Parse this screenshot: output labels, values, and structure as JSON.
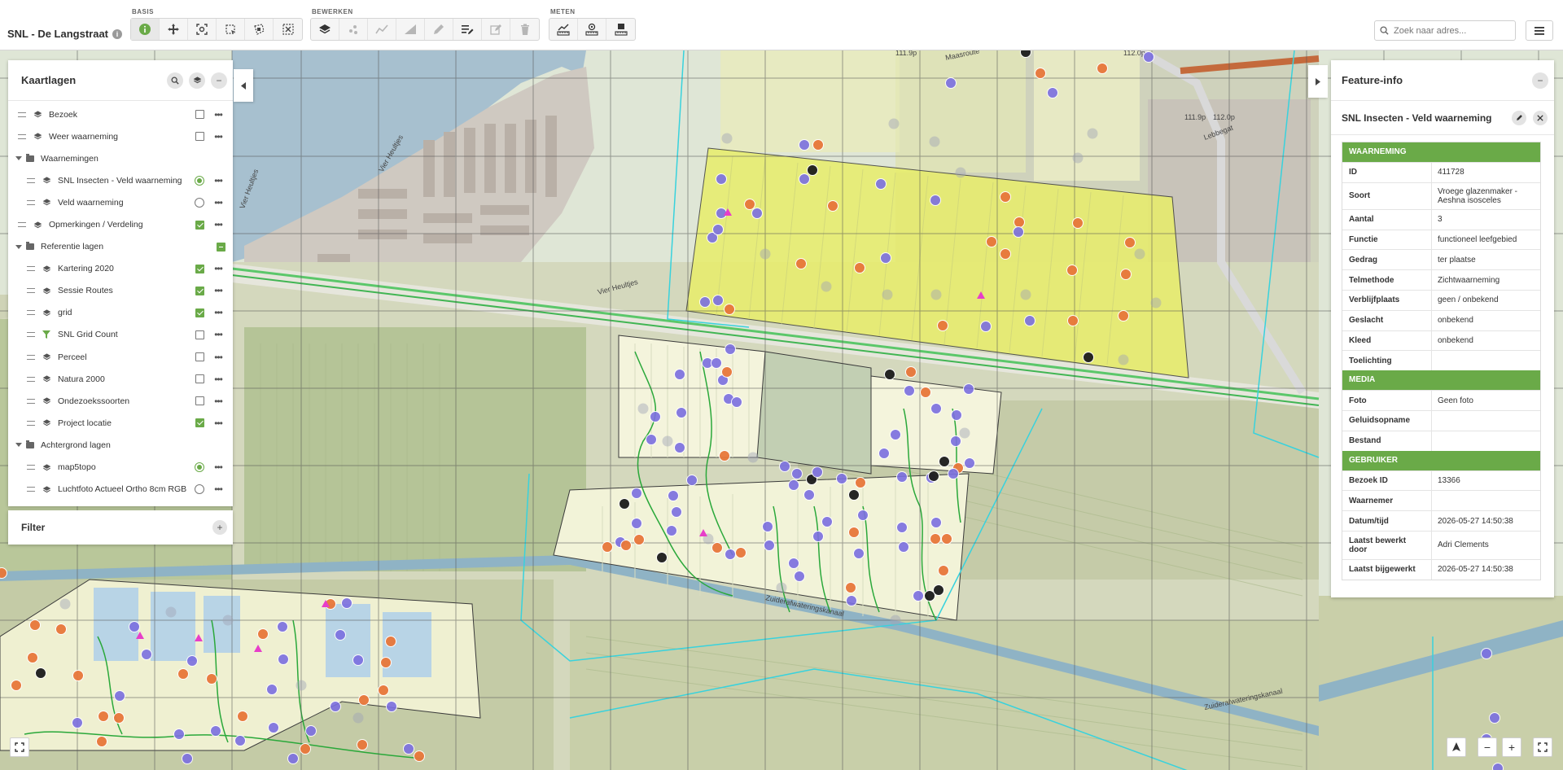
{
  "app": {
    "title": "SNL - De Langstraat",
    "info_icon": "info-icon"
  },
  "toolbar": {
    "groups": [
      {
        "label": "BASIS",
        "buttons": [
          "info-tool",
          "pan-tool",
          "zoom-extent-tool",
          "select-box-tool",
          "select-polygon-tool",
          "clear-selection-tool"
        ]
      },
      {
        "label": "BEWERKEN",
        "buttons": [
          "layer-edit-tool",
          "points-tool",
          "line-tool",
          "polygon-tool",
          "draw-tool",
          "edit-list-tool",
          "edit-tool",
          "delete-tool"
        ]
      },
      {
        "label": "METEN",
        "buttons": [
          "measure-line-tool",
          "measure-point-tool",
          "measure-area-tool"
        ]
      }
    ]
  },
  "search": {
    "placeholder": "Zoek naar adres...",
    "value": ""
  },
  "layers": {
    "title": "Kaartlagen",
    "items": [
      {
        "name": "Bezoek",
        "kind": "layer",
        "indent": 0,
        "control": "checkbox",
        "state": "off"
      },
      {
        "name": "Weer waarneming",
        "kind": "layer",
        "indent": 0,
        "control": "checkbox",
        "state": "off"
      },
      {
        "name": "Waarnemingen",
        "kind": "group",
        "indent": 0,
        "control": "none",
        "state": ""
      },
      {
        "name": "SNL Insecten - Veld waarneming",
        "kind": "layer",
        "indent": 1,
        "control": "radio",
        "state": "on"
      },
      {
        "name": "Veld waarneming",
        "kind": "layer",
        "indent": 1,
        "control": "radio",
        "state": "off"
      },
      {
        "name": "Opmerkingen / Verdeling",
        "kind": "layer",
        "indent": 0,
        "control": "checkbox",
        "state": "on"
      },
      {
        "name": "Referentie lagen",
        "kind": "group",
        "indent": 0,
        "control": "checkbox",
        "state": "partial"
      },
      {
        "name": "Kartering 2020",
        "kind": "layer",
        "indent": 1,
        "control": "checkbox",
        "state": "on"
      },
      {
        "name": "Sessie Routes",
        "kind": "layer",
        "indent": 1,
        "control": "checkbox",
        "state": "on"
      },
      {
        "name": "grid",
        "kind": "layer",
        "indent": 1,
        "control": "checkbox",
        "state": "on"
      },
      {
        "name": "SNL Grid Count",
        "kind": "filter",
        "indent": 1,
        "control": "checkbox",
        "state": "off"
      },
      {
        "name": "Perceel",
        "kind": "layer",
        "indent": 1,
        "control": "checkbox",
        "state": "off"
      },
      {
        "name": "Natura 2000",
        "kind": "layer",
        "indent": 1,
        "control": "checkbox",
        "state": "off"
      },
      {
        "name": "Ondezoekssoorten",
        "kind": "layer",
        "indent": 1,
        "control": "checkbox",
        "state": "off"
      },
      {
        "name": "Project locatie",
        "kind": "layer",
        "indent": 1,
        "control": "checkbox",
        "state": "on"
      },
      {
        "name": "Achtergrond lagen",
        "kind": "group",
        "indent": 0,
        "control": "none",
        "state": ""
      },
      {
        "name": "map5topo",
        "kind": "layer",
        "indent": 1,
        "control": "radio",
        "state": "on"
      },
      {
        "name": "Luchtfoto Actueel Ortho 8cm RGB",
        "kind": "layer",
        "indent": 1,
        "control": "radio",
        "state": "off"
      }
    ]
  },
  "filter": {
    "title": "Filter"
  },
  "feature_info": {
    "title": "Feature-info",
    "subtitle": "SNL Insecten - Veld waarneming",
    "sections": [
      {
        "title": "WAARNEMING",
        "rows": [
          {
            "key": "ID",
            "value": "411728"
          },
          {
            "key": "Soort",
            "value": "Vroege glazenmaker - Aeshna isosceles"
          },
          {
            "key": "Aantal",
            "value": "3"
          },
          {
            "key": "Functie",
            "value": "functioneel leefgebied"
          },
          {
            "key": "Gedrag",
            "value": "ter plaatse"
          },
          {
            "key": "Telmethode",
            "value": "Zichtwaarneming"
          },
          {
            "key": "Verblijfplaats",
            "value": "geen / onbekend"
          },
          {
            "key": "Geslacht",
            "value": "onbekend"
          },
          {
            "key": "Kleed",
            "value": "onbekend"
          },
          {
            "key": "Toelichting",
            "value": ""
          }
        ]
      },
      {
        "title": "MEDIA",
        "rows": [
          {
            "key": "Foto",
            "value": "Geen foto"
          },
          {
            "key": "Geluidsopname",
            "value": ""
          },
          {
            "key": "Bestand",
            "value": ""
          }
        ]
      },
      {
        "title": "GEBRUIKER",
        "rows": [
          {
            "key": "Bezoek ID",
            "value": "13366"
          },
          {
            "key": "Waarnemer",
            "value": ""
          },
          {
            "key": "Datum/tijd",
            "value": "2026-05-27 14:50:38"
          },
          {
            "key": "Laatst bewerkt door",
            "value": "Adri Clements"
          },
          {
            "key": "Laatst bijgewerkt",
            "value": "2026-05-27 14:50:38"
          }
        ]
      }
    ]
  },
  "map_labels": {
    "street_1": "Vier Heultjes",
    "street_2": "Vier Heultjes",
    "street_3": "Vier Heultjes",
    "street_4": "Maasroute",
    "canal_1": "Zuiderafwateringskanaal",
    "canal_2": "Zuiderafwateringskanaal",
    "elev_1": "111.9p",
    "elev_2": "112.0p",
    "elev_3": "111.9p",
    "elev_4": "112.0p",
    "road_1": "Lebbegat"
  },
  "colors": {
    "accent_green": "#6aaa48",
    "marker_purple": "#7b6fe0",
    "marker_orange": "#e8773a",
    "marker_black": "#1c1c1c",
    "project_yellow": "#e8ee6a"
  }
}
